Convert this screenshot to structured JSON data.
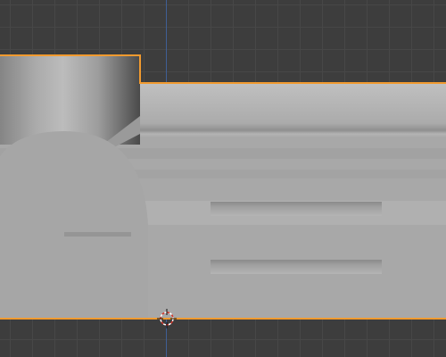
{
  "viewport": {
    "mode": "3d-viewport",
    "background_color": "#3d3d3d",
    "grid_color": "#474747",
    "y_axis_color": "#3f5f95",
    "selection_outline_color": "#f19a2f"
  },
  "selected_object": {
    "selected": true,
    "shading": "solid",
    "surface_color": "#a9a9a9"
  },
  "cursor_3d": {
    "icon": "3d-cursor-icon",
    "colors": [
      "#d6362b",
      "#ffffff"
    ]
  }
}
